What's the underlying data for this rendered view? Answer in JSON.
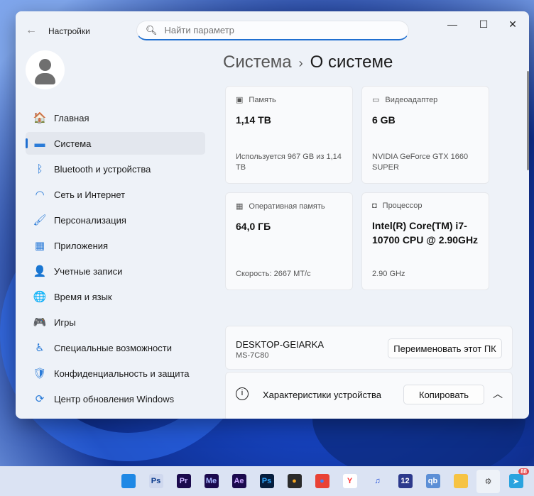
{
  "window": {
    "title": "Настройки",
    "search_placeholder": "Найти параметр",
    "minimize": "—",
    "maximize": "☐",
    "close": "✕"
  },
  "nav": [
    {
      "label": "Главная",
      "icon": "home-icon",
      "glyph": "🏠"
    },
    {
      "label": "Система",
      "icon": "system-icon",
      "glyph": "▬"
    },
    {
      "label": "Bluetooth и устройства",
      "icon": "bluetooth-icon",
      "glyph": "ᛒ"
    },
    {
      "label": "Сеть и Интернет",
      "icon": "wifi-icon",
      "glyph": "◠"
    },
    {
      "label": "Персонализация",
      "icon": "brush-icon",
      "glyph": "🖌"
    },
    {
      "label": "Приложения",
      "icon": "apps-icon",
      "glyph": "▦"
    },
    {
      "label": "Учетные записи",
      "icon": "account-icon",
      "glyph": "👤"
    },
    {
      "label": "Время и язык",
      "icon": "globe-clock-icon",
      "glyph": "🌐"
    },
    {
      "label": "Игры",
      "icon": "gamepad-icon",
      "glyph": "🎮"
    },
    {
      "label": "Специальные возможности",
      "icon": "accessibility-icon",
      "glyph": "♿"
    },
    {
      "label": "Конфиденциальность и защита",
      "icon": "shield-icon",
      "glyph": "🛡"
    },
    {
      "label": "Центр обновления Windows",
      "icon": "update-icon",
      "glyph": "⟳"
    }
  ],
  "breadcrumb": {
    "parent": "Система",
    "separator": "›",
    "current": "О системе"
  },
  "cards": [
    {
      "label": "Память",
      "value": "1,14 TB",
      "sub": "Используется 967 GB из 1,14 TB",
      "icon": "storage-icon"
    },
    {
      "label": "Видеоадаптер",
      "value": "6 GB",
      "sub": "NVIDIA GeForce GTX 1660 SUPER",
      "icon": "gpu-icon"
    },
    {
      "label": "Оперативная память",
      "value": "64,0 ГБ",
      "sub": "Скорость: 2667 MT/с",
      "icon": "ram-icon"
    },
    {
      "label": "Процессор",
      "value": "Intel(R) Core(TM) i7-10700 CPU @ 2.90GHz",
      "sub": "2.90 GHz",
      "icon": "cpu-icon"
    }
  ],
  "device": {
    "name": "DESKTOP-GEIARKA",
    "model": "MS-7C80",
    "rename_label": "Переименовать этот ПК"
  },
  "specs": {
    "title": "Характеристики устройства",
    "copy_label": "Копировать"
  },
  "taskbar": [
    {
      "name": "start",
      "t": "",
      "bg": "#1e88e5",
      "fg": "#fff"
    },
    {
      "name": "photoshop-old",
      "t": "Ps",
      "bg": "#cfd8ee",
      "fg": "#0b3b8c"
    },
    {
      "name": "premiere",
      "t": "Pr",
      "bg": "#1b0a4d",
      "fg": "#c9b6ff"
    },
    {
      "name": "media-encoder",
      "t": "Me",
      "bg": "#1b0a4d",
      "fg": "#a5b4ff"
    },
    {
      "name": "after-effects",
      "t": "Ae",
      "bg": "#1b0a4d",
      "fg": "#c8a5ff"
    },
    {
      "name": "photoshop",
      "t": "Ps",
      "bg": "#061e3d",
      "fg": "#31a8ff"
    },
    {
      "name": "davinci",
      "t": "●",
      "bg": "#2b2b2b",
      "fg": "#f5a623"
    },
    {
      "name": "chrome",
      "t": "●",
      "bg": "#e94235",
      "fg": "#4285f4"
    },
    {
      "name": "yandex",
      "t": "Y",
      "bg": "#ffffff",
      "fg": "#f33"
    },
    {
      "name": "audacity",
      "t": "♫",
      "bg": "#dbe3f3",
      "fg": "#1e4bd6"
    },
    {
      "name": "floppy-app",
      "t": "12",
      "bg": "#2d3a8c",
      "fg": "#fff"
    },
    {
      "name": "qbittorrent",
      "t": "qb",
      "bg": "#5c8fd6",
      "fg": "#fff"
    },
    {
      "name": "file-explorer",
      "t": "",
      "bg": "#f6c343",
      "fg": "#000"
    },
    {
      "name": "settings",
      "t": "⚙",
      "bg": "#eef2f8",
      "fg": "#444"
    },
    {
      "name": "telegram",
      "t": "➤",
      "bg": "#2aa3df",
      "fg": "#fff",
      "badge": "88"
    }
  ]
}
